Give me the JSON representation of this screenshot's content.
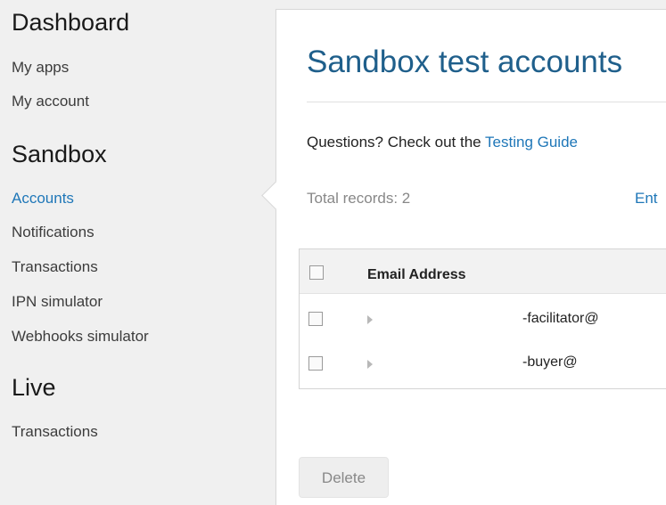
{
  "sidebar": {
    "sections": [
      {
        "heading": "Dashboard",
        "items": [
          "My apps",
          "My account"
        ]
      },
      {
        "heading": "Sandbox",
        "items": [
          "Accounts",
          "Notifications",
          "Transactions",
          "IPN simulator",
          "Webhooks simulator"
        ]
      },
      {
        "heading": "Live",
        "items": [
          "Transactions"
        ]
      }
    ],
    "active_item": "Accounts"
  },
  "main": {
    "title": "Sandbox test accounts",
    "questions_prefix": "Questions? Check out the ",
    "questions_link": "Testing Guide",
    "total_records": "Total records: 2",
    "partial_link": "Ent",
    "table": {
      "columns": [
        "Email Address"
      ],
      "rows": [
        {
          "email": "-facilitator@"
        },
        {
          "email": "-buyer@"
        }
      ]
    },
    "delete_label": "Delete"
  },
  "colors": {
    "accent": "#1f77b8",
    "title": "#1f5f8b",
    "background": "#f0f0f0"
  }
}
